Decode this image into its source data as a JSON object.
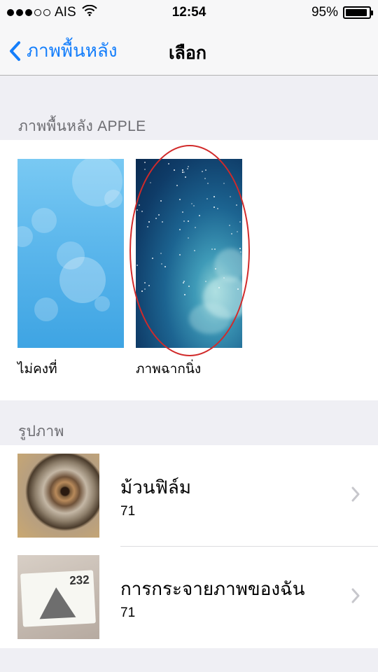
{
  "status_bar": {
    "carrier": "AIS",
    "time": "12:54",
    "battery_percent_label": "95%",
    "battery_level": 0.95,
    "signal_bars_filled": 3,
    "signal_bars_total": 5
  },
  "nav": {
    "back_label": "ภาพพื้นหลัง",
    "title": "เลือก"
  },
  "apple_section": {
    "header": "ภาพพื้นหลัง APPLE",
    "items": [
      {
        "label": "ไม่คงที่"
      },
      {
        "label": "ภาพฉากนิ่ง"
      }
    ]
  },
  "photos_section": {
    "header": "รูปภาพ",
    "albums": [
      {
        "title": "ม้วนฟิล์ม",
        "count": "71"
      },
      {
        "title": "การกระจายภาพของฉัน",
        "count": "71",
        "thumb_text": "232"
      }
    ]
  },
  "colors": {
    "accent": "#147efb",
    "annotation": "#d12a2a"
  }
}
